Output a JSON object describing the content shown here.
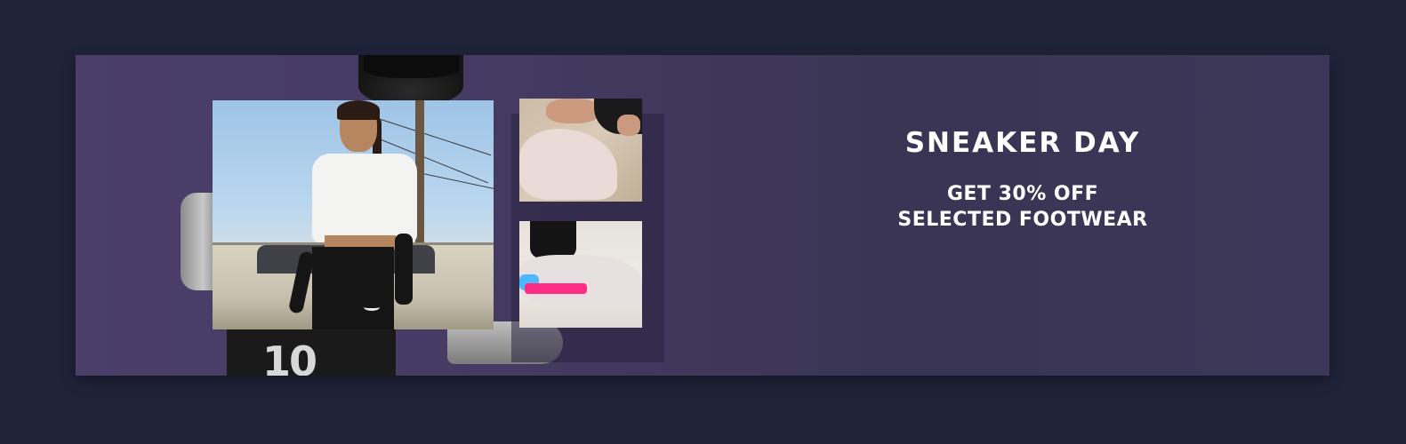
{
  "banner": {
    "title": "SNEAKER DAY",
    "subtitle_line1": "GET 30% OFF",
    "subtitle_line2": "SELECTED FOOTWEAR",
    "jersey_number": "10"
  },
  "colors": {
    "page_background": "#1f233a",
    "banner_start": "#4b3f6a",
    "banner_end": "#3c3658",
    "text": "#ffffff"
  },
  "images": {
    "hero": "athlete-cutout",
    "main_photo": "woman-streetwear-photo",
    "small_photo_1": "tying-sneaker-photo",
    "small_photo_2": "sneaker-closeup-photo"
  }
}
